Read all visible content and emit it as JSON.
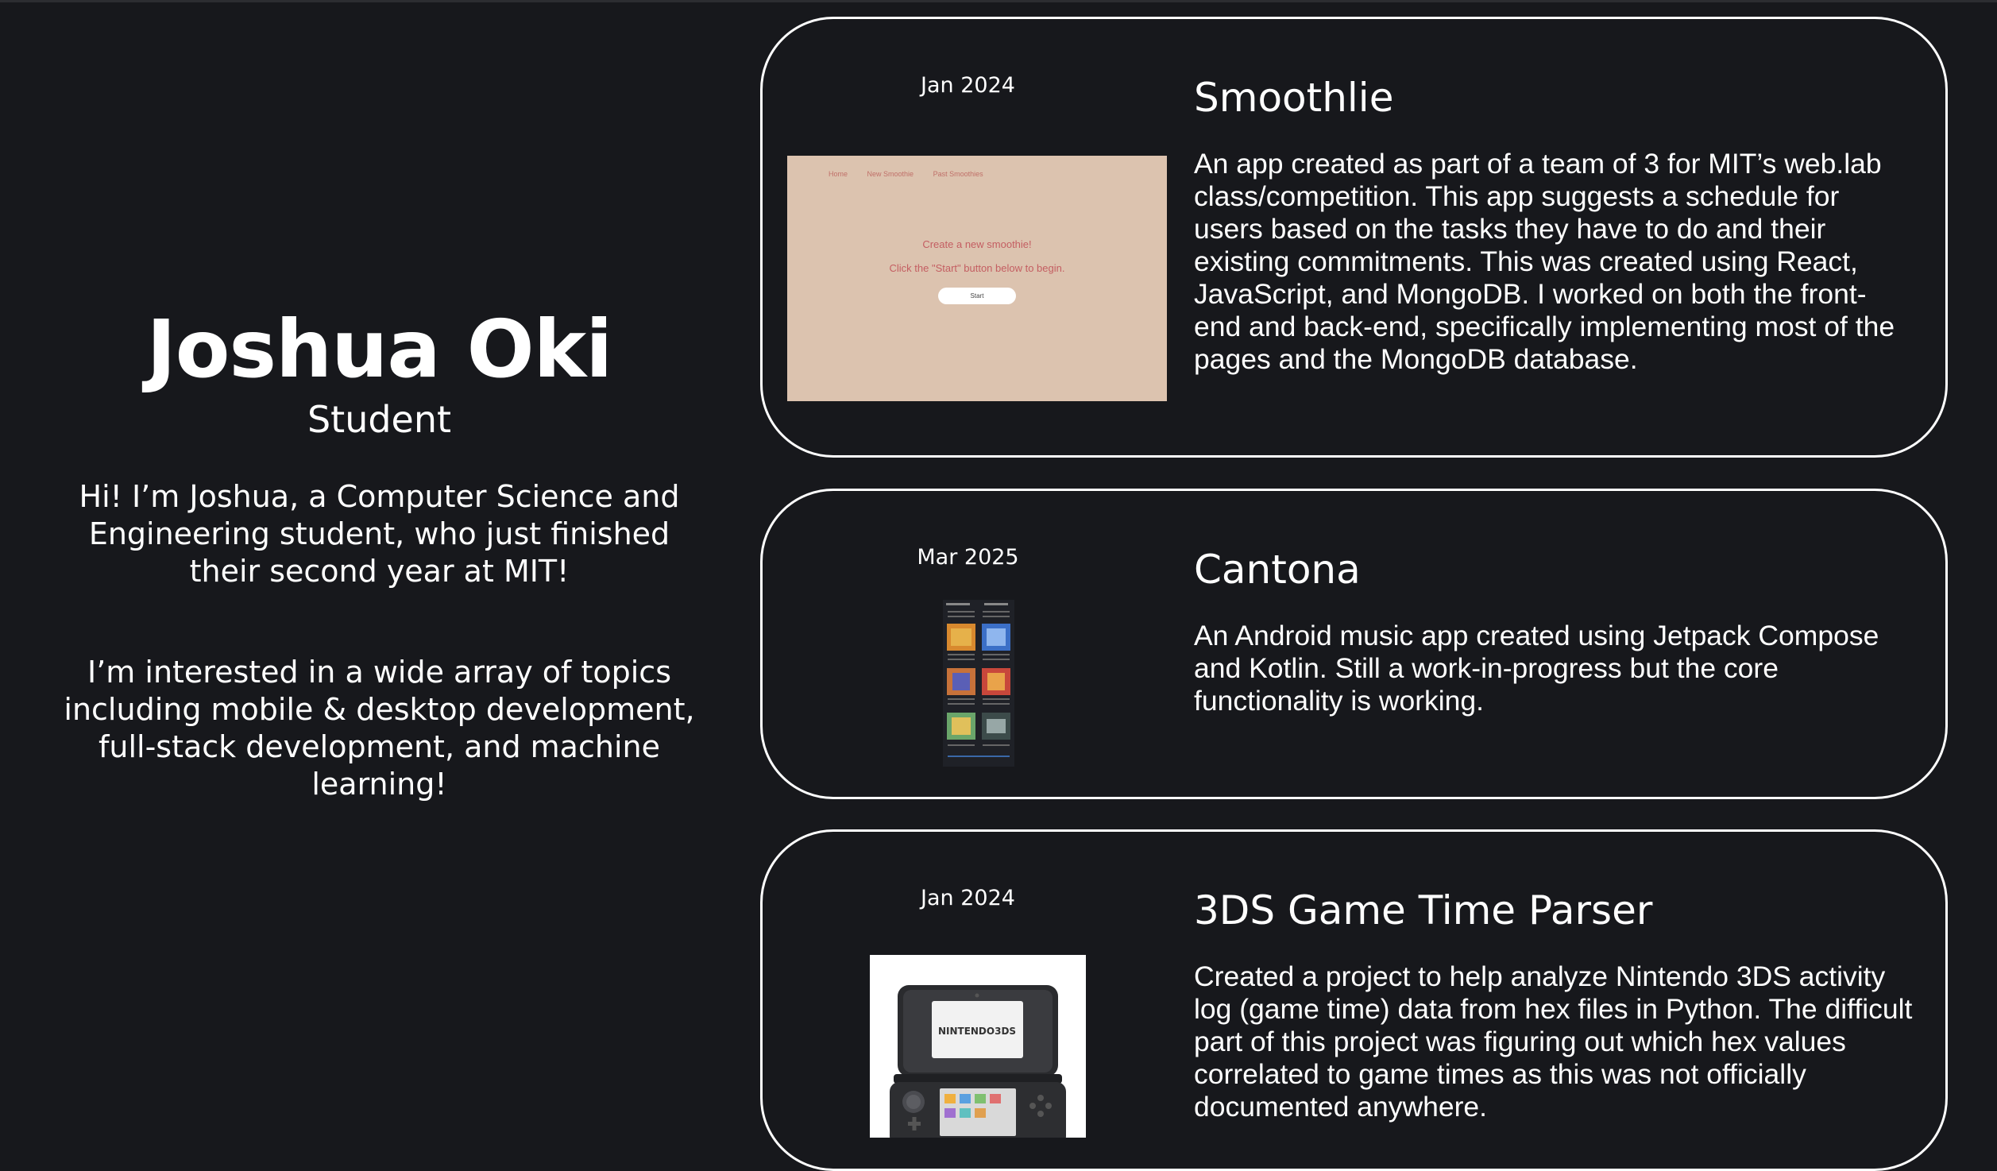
{
  "profile": {
    "name": "Joshua Oki",
    "role": "Student",
    "bio_1": "Hi! I’m Joshua, a Computer Science and Engineering student, who just finished their second year at MIT!",
    "bio_2": "I’m interested in a wide array of topics including mobile & desktop development, full-stack development, and machine learning!"
  },
  "projects": [
    {
      "date": "Jan 2024",
      "title": "Smoothlie",
      "description": "An app created as part of a team of 3 for MIT’s web.lab class/competition. This app suggests a schedule for users based on the tasks they have to do and their existing commitments. This was created using React, JavaScript, and MongoDB. I worked on both the front-end and back-end, specifically implementing most of the pages and the MongoDB database.",
      "screenshot": {
        "nav": [
          "Home",
          "New Smoothie",
          "Past Smoothies"
        ],
        "heading": "Create a new smoothie!",
        "subheading": "Click the \"Start\" button below to begin.",
        "button": "Start"
      }
    },
    {
      "date": "Mar 2025",
      "title": "Cantona",
      "description": "An Android music app created using Jetpack Compose and Kotlin. Still a work-in-progress but the core functionality is working."
    },
    {
      "date": "Jan 2024",
      "title": "3DS Game Time Parser",
      "description": "Created a project to help analyze Nintendo 3DS activity log (game time) data from hex files in Python. The difficult part of this project was figuring out which hex values correlated to game times as this was not officially documented anywhere.",
      "image_label": "NINTENDO3DS"
    }
  ],
  "colors": {
    "background": "#17181c",
    "text": "#ffffff",
    "card_border": "#ffffff",
    "smoothlie_bg": "#dcc3af",
    "smoothlie_accent": "#c45e62"
  }
}
